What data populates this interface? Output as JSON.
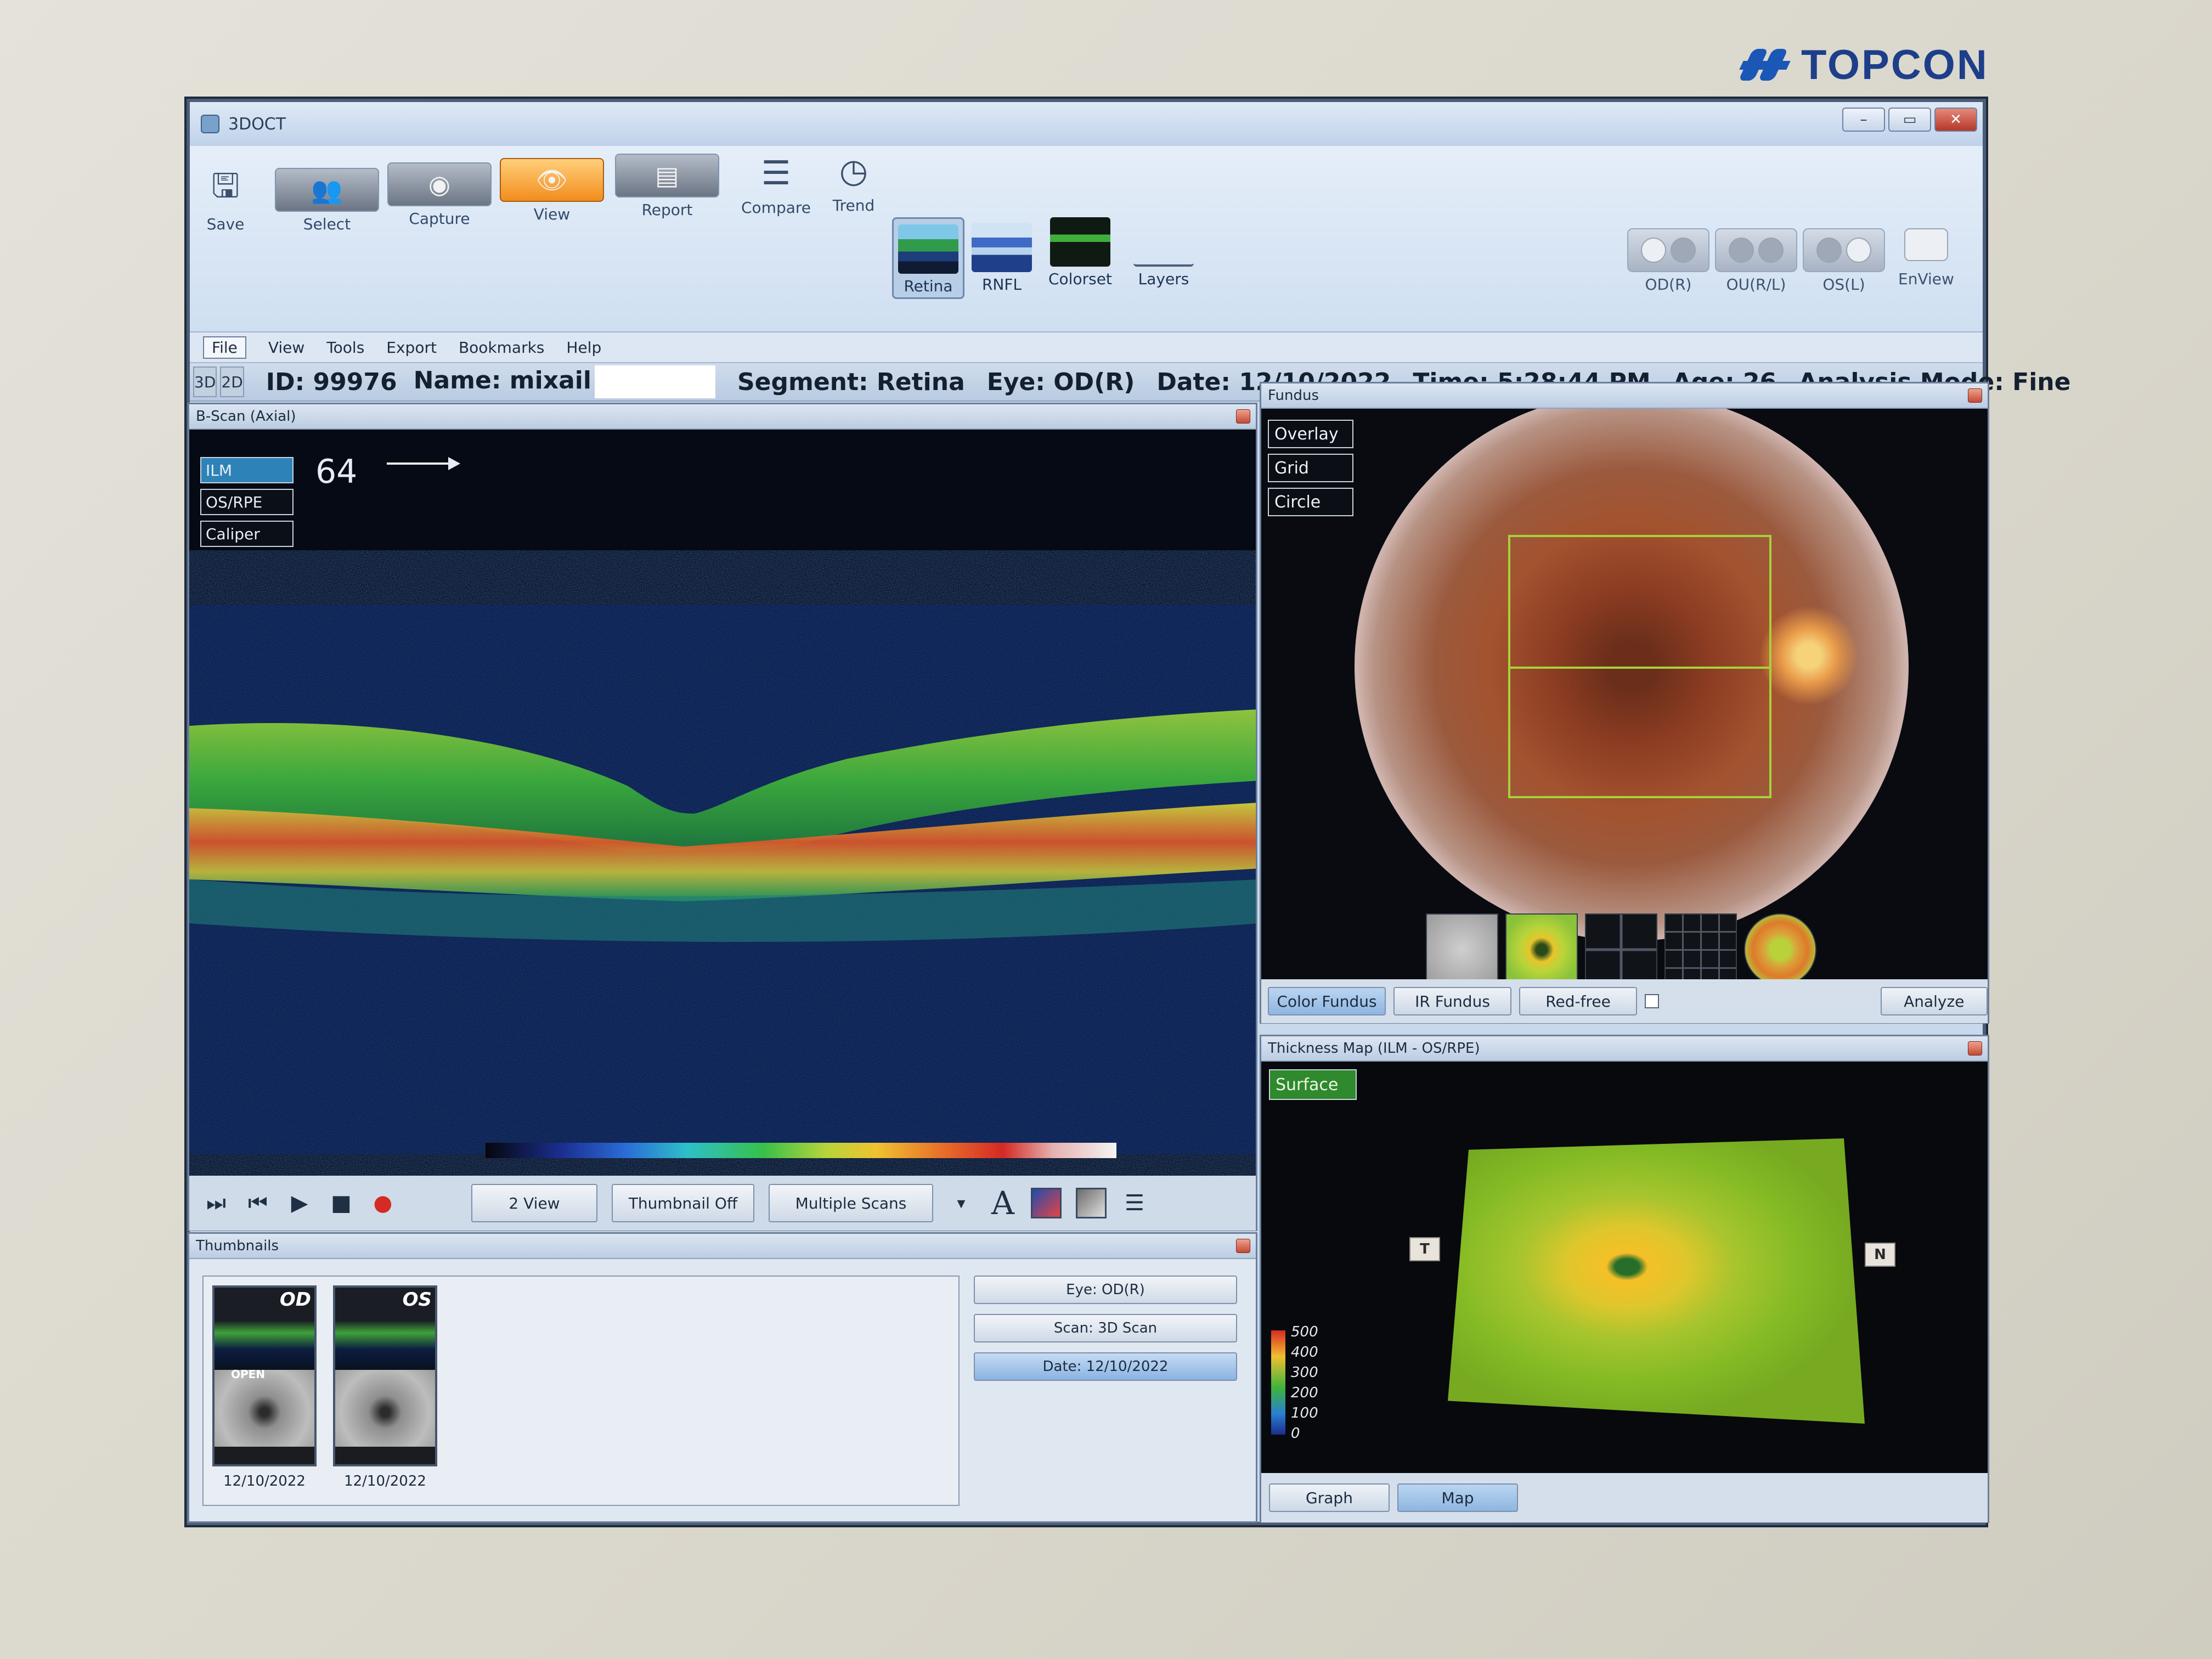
{
  "brand": {
    "name": "TOPCON"
  },
  "window": {
    "title": "3DOCT",
    "controls": [
      "–",
      "▭",
      "✕"
    ]
  },
  "toolbar": {
    "save_label": "Save",
    "select_label": "Select",
    "capture_label": "Capture",
    "view_label": "View",
    "report_label": "Report",
    "compare_label": "Compare",
    "trend_label": "Trend",
    "retina_label": "Retina",
    "rnfl_label": "RNFL",
    "colorset_label": "Colorset",
    "layers_label": "Layers",
    "od_label": "OD(R)",
    "ou_label": "OU(R/L)",
    "os_label": "OS(L)",
    "enview_label": "EnView"
  },
  "menu": [
    "File",
    "View",
    "Tools",
    "Export",
    "Bookmarks",
    "Help"
  ],
  "view_tabs": [
    "3D",
    "2D"
  ],
  "patient": {
    "id": "ID: 99976",
    "name": "Name: mixail",
    "segment": "Segment: Retina",
    "eye": "Eye: OD(R)",
    "date": "Date: 12/10/2022",
    "time": "Time: 5:28:44 PM",
    "age": "Age: 26",
    "analysis_mode": "Analysis Mode: Fine"
  },
  "bscan": {
    "title": "B-Scan (Axial)",
    "layers": [
      "ILM",
      "OS/RPE",
      "Caliper"
    ],
    "slice": "64",
    "controls": {
      "two_view": "2 View",
      "thumbnail_off": "Thumbnail Off",
      "multiple_scans": "Multiple Scans",
      "text_tool": "A"
    }
  },
  "thumbnails": {
    "title": "Thumbnails",
    "items": [
      {
        "eye": "OD",
        "date": "12/10/2022",
        "tag": "OPEN"
      },
      {
        "eye": "OS",
        "date": "12/10/2022",
        "tag": ""
      }
    ],
    "info": {
      "eye": "Eye: OD(R)",
      "scan": "Scan: 3D Scan",
      "date": "Date: 12/10/2022"
    }
  },
  "fundus": {
    "title": "Fundus",
    "overlay_buttons": [
      "Overlay",
      "Grid",
      "Circle"
    ],
    "tabs": {
      "color": "Color Fundus",
      "ir": "IR Fundus",
      "redfree": "Red-free",
      "analyze": "Analyze"
    }
  },
  "thickness": {
    "title": "Thickness Map  (ILM - OS/RPE)",
    "surface_label": "Surface",
    "temporal": "T",
    "nasal": "N",
    "legend": [
      "500",
      "400",
      "300",
      "200",
      "100",
      "0"
    ],
    "tabs": {
      "graph": "Graph",
      "map": "Map"
    }
  },
  "colors": {
    "accent_orange": "#f28d1d",
    "scan_box_green": "#a6d13a",
    "brand_blue": "#1b57b7"
  }
}
